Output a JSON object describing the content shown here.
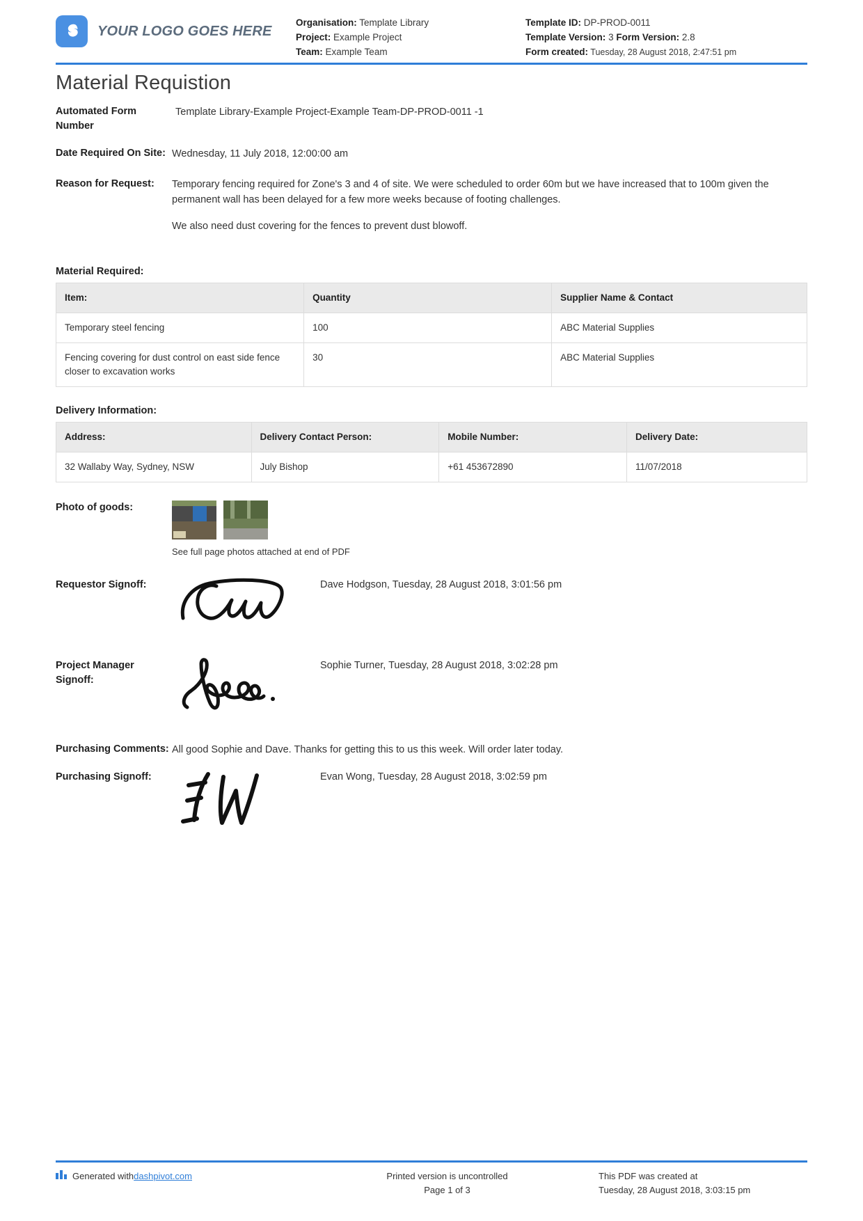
{
  "header": {
    "logo_text": "YOUR LOGO GOES HERE",
    "logo_color": "#4a90e2",
    "organisation_label": "Organisation:",
    "organisation_value": "Template Library",
    "project_label": "Project:",
    "project_value": "Example Project",
    "team_label": "Team:",
    "team_value": "Example Team",
    "template_id_label": "Template ID:",
    "template_id_value": "DP-PROD-0011",
    "template_version_label": "Template Version:",
    "template_version_value": "3",
    "form_version_label": "Form Version:",
    "form_version_value": "2.8",
    "form_created_label": "Form created:",
    "form_created_value": "Tuesday, 28 August 2018, 2:47:51 pm"
  },
  "title": "Material Requistion",
  "fields": {
    "automated_form_number_label": "Automated Form Number",
    "automated_form_number_value": "Template Library-Example Project-Example Team-DP-PROD-0011   -1",
    "date_required_label": "Date Required On Site:",
    "date_required_value": "Wednesday, 11 July 2018, 12:00:00 am",
    "reason_label": "Reason for Request:",
    "reason_paragraph_1": "Temporary fencing required for Zone's 3 and 4 of site. We were scheduled to order 60m but we have increased that to 100m given the permanent wall has been delayed for a few more weeks because of footing challenges.",
    "reason_paragraph_2": "We also need dust covering for the fences to prevent dust blowoff."
  },
  "material": {
    "section_title": "Material Required:",
    "columns": [
      "Item:",
      "Quantity",
      "Supplier Name & Contact"
    ],
    "rows": [
      [
        "Temporary steel fencing",
        "100",
        "ABC Material Supplies"
      ],
      [
        "Fencing covering for dust control on east side fence closer to excavation works",
        "30",
        "ABC Material Supplies"
      ]
    ]
  },
  "delivery": {
    "section_title": "Delivery Information:",
    "columns": [
      "Address:",
      "Delivery Contact Person:",
      "Mobile Number:",
      "Delivery Date:"
    ],
    "rows": [
      [
        "32 Wallaby Way, Sydney, NSW",
        "July Bishop",
        "+61 453672890",
        "11/07/2018"
      ]
    ]
  },
  "photos": {
    "label": "Photo of goods:",
    "caption": "See full page photos attached at end of PDF",
    "count": 2
  },
  "signoffs": [
    {
      "label": "Requestor Signoff:",
      "name_and_time": "Dave Hodgson, Tuesday, 28 August 2018, 3:01:56 pm",
      "signature": "cursive-signature-dave"
    },
    {
      "label": "Project Manager Signoff:",
      "name_and_time": "Sophie Turner, Tuesday, 28 August 2018, 3:02:28 pm",
      "signature": "cursive-signature-sophie"
    }
  ],
  "purchasing": {
    "comments_label": "Purchasing Comments:",
    "comments_value": "All good Sophie and Dave. Thanks for getting this to us this week. Will order later today.",
    "signoff_label": "Purchasing Signoff:",
    "signoff_name_and_time": "Evan Wong, Tuesday, 28 August 2018, 3:02:59 pm",
    "signature": "initials-signature-ew"
  },
  "footer": {
    "generated_with_prefix": "Generated with ",
    "generated_with_link": "dashpivot.com",
    "printed_notice": "Printed version is uncontrolled",
    "page_number": "Page 1 of 3",
    "created_at_label": "This PDF was created at",
    "created_at_value": "Tuesday, 28 August 2018, 3:03:15 pm"
  }
}
